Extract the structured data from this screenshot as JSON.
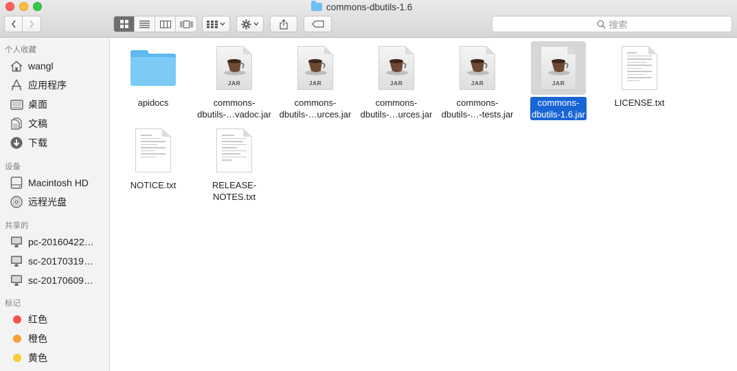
{
  "window": {
    "title": "commons-dbutils-1.6"
  },
  "toolbar": {
    "search_placeholder": "搜索",
    "icons": {
      "back": "chevron-left-icon",
      "forward": "chevron-right-icon",
      "views": [
        "icon-view-icon",
        "list-view-icon",
        "column-view-icon",
        "coverflow-view-icon"
      ],
      "arrange": "arrange-grid-icon",
      "action": "gear-icon",
      "share": "share-icon",
      "tag": "tag-icon"
    }
  },
  "sidebar": {
    "favorites_title": "个人收藏",
    "favorites": [
      {
        "label": "wangl",
        "icon": "home-icon"
      },
      {
        "label": "应用程序",
        "icon": "applications-icon"
      },
      {
        "label": "桌面",
        "icon": "desktop-icon"
      },
      {
        "label": "文稿",
        "icon": "documents-icon"
      },
      {
        "label": "下载",
        "icon": "download-icon"
      }
    ],
    "devices_title": "设备",
    "devices": [
      {
        "label": "Macintosh HD",
        "icon": "hard-drive-icon"
      },
      {
        "label": "远程光盘",
        "icon": "disc-icon"
      }
    ],
    "shared_title": "共享的",
    "shared": [
      {
        "label": "pc-20160422…",
        "icon": "computer-icon"
      },
      {
        "label": "sc-20170319…",
        "icon": "computer-icon"
      },
      {
        "label": "sc-20170609…",
        "icon": "computer-icon"
      }
    ],
    "tags_title": "标记",
    "tags": [
      {
        "label": "红色",
        "color": "#f5514f"
      },
      {
        "label": "橙色",
        "color": "#f9a035"
      },
      {
        "label": "黄色",
        "color": "#f8cd37"
      }
    ]
  },
  "files": [
    {
      "name_l1": "apidocs",
      "name_l2": "",
      "type": "folder"
    },
    {
      "name_l1": "commons-",
      "name_l2": "dbutils-…vadoc.jar",
      "type": "jar",
      "badge": "JAR"
    },
    {
      "name_l1": "commons-",
      "name_l2": "dbutils-…urces.jar",
      "type": "jar",
      "badge": "JAR"
    },
    {
      "name_l1": "commons-",
      "name_l2": "dbutils-…urces.jar",
      "type": "jar",
      "badge": "JAR"
    },
    {
      "name_l1": "commons-",
      "name_l2": "dbutils-…-tests.jar",
      "type": "jar",
      "badge": "JAR"
    },
    {
      "name_l1": "commons-",
      "name_l2": "dbutils-1.6.jar",
      "type": "jar",
      "badge": "JAR",
      "selected": true
    },
    {
      "name_l1": "LICENSE.txt",
      "name_l2": "",
      "type": "txt"
    },
    {
      "name_l1": "NOTICE.txt",
      "name_l2": "",
      "type": "txt"
    },
    {
      "name_l1": "RELEASE-",
      "name_l2": "NOTES.txt",
      "type": "txt"
    }
  ]
}
